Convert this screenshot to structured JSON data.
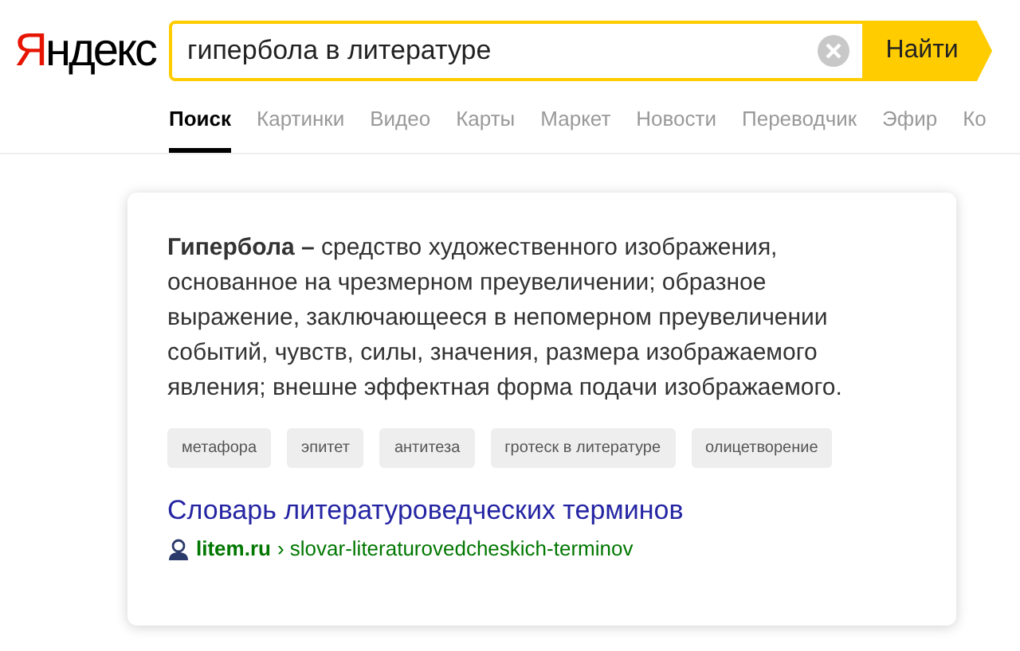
{
  "logo": {
    "first": "Я",
    "rest": "ндекс"
  },
  "search": {
    "value": "гипербола в литературе",
    "button": "Найти"
  },
  "tabs": [
    {
      "label": "Поиск",
      "selected": true
    },
    {
      "label": "Картинки",
      "selected": false
    },
    {
      "label": "Видео",
      "selected": false
    },
    {
      "label": "Карты",
      "selected": false
    },
    {
      "label": "Маркет",
      "selected": false
    },
    {
      "label": "Новости",
      "selected": false
    },
    {
      "label": "Переводчик",
      "selected": false
    },
    {
      "label": "Эфир",
      "selected": false
    },
    {
      "label": "Ко",
      "selected": false
    }
  ],
  "card": {
    "definition": "**Гипербола –** средство художественного изображения, основанное на чрезмерном преувеличении;  образное выражение, заключающееся в непомерном преувеличении событий, чувств, силы, значения, размера изображаемого явления; внешне эффектная форма подачи изображаемого.",
    "tags": [
      "метафора",
      "эпитет",
      "антитеза",
      "гротеск в литературе",
      "олицетворение"
    ],
    "source_title": "Словарь литературоведческих терминов",
    "source_domain": "litem.ru",
    "source_path": "› slovar-literaturovedcheskich-terminov"
  }
}
